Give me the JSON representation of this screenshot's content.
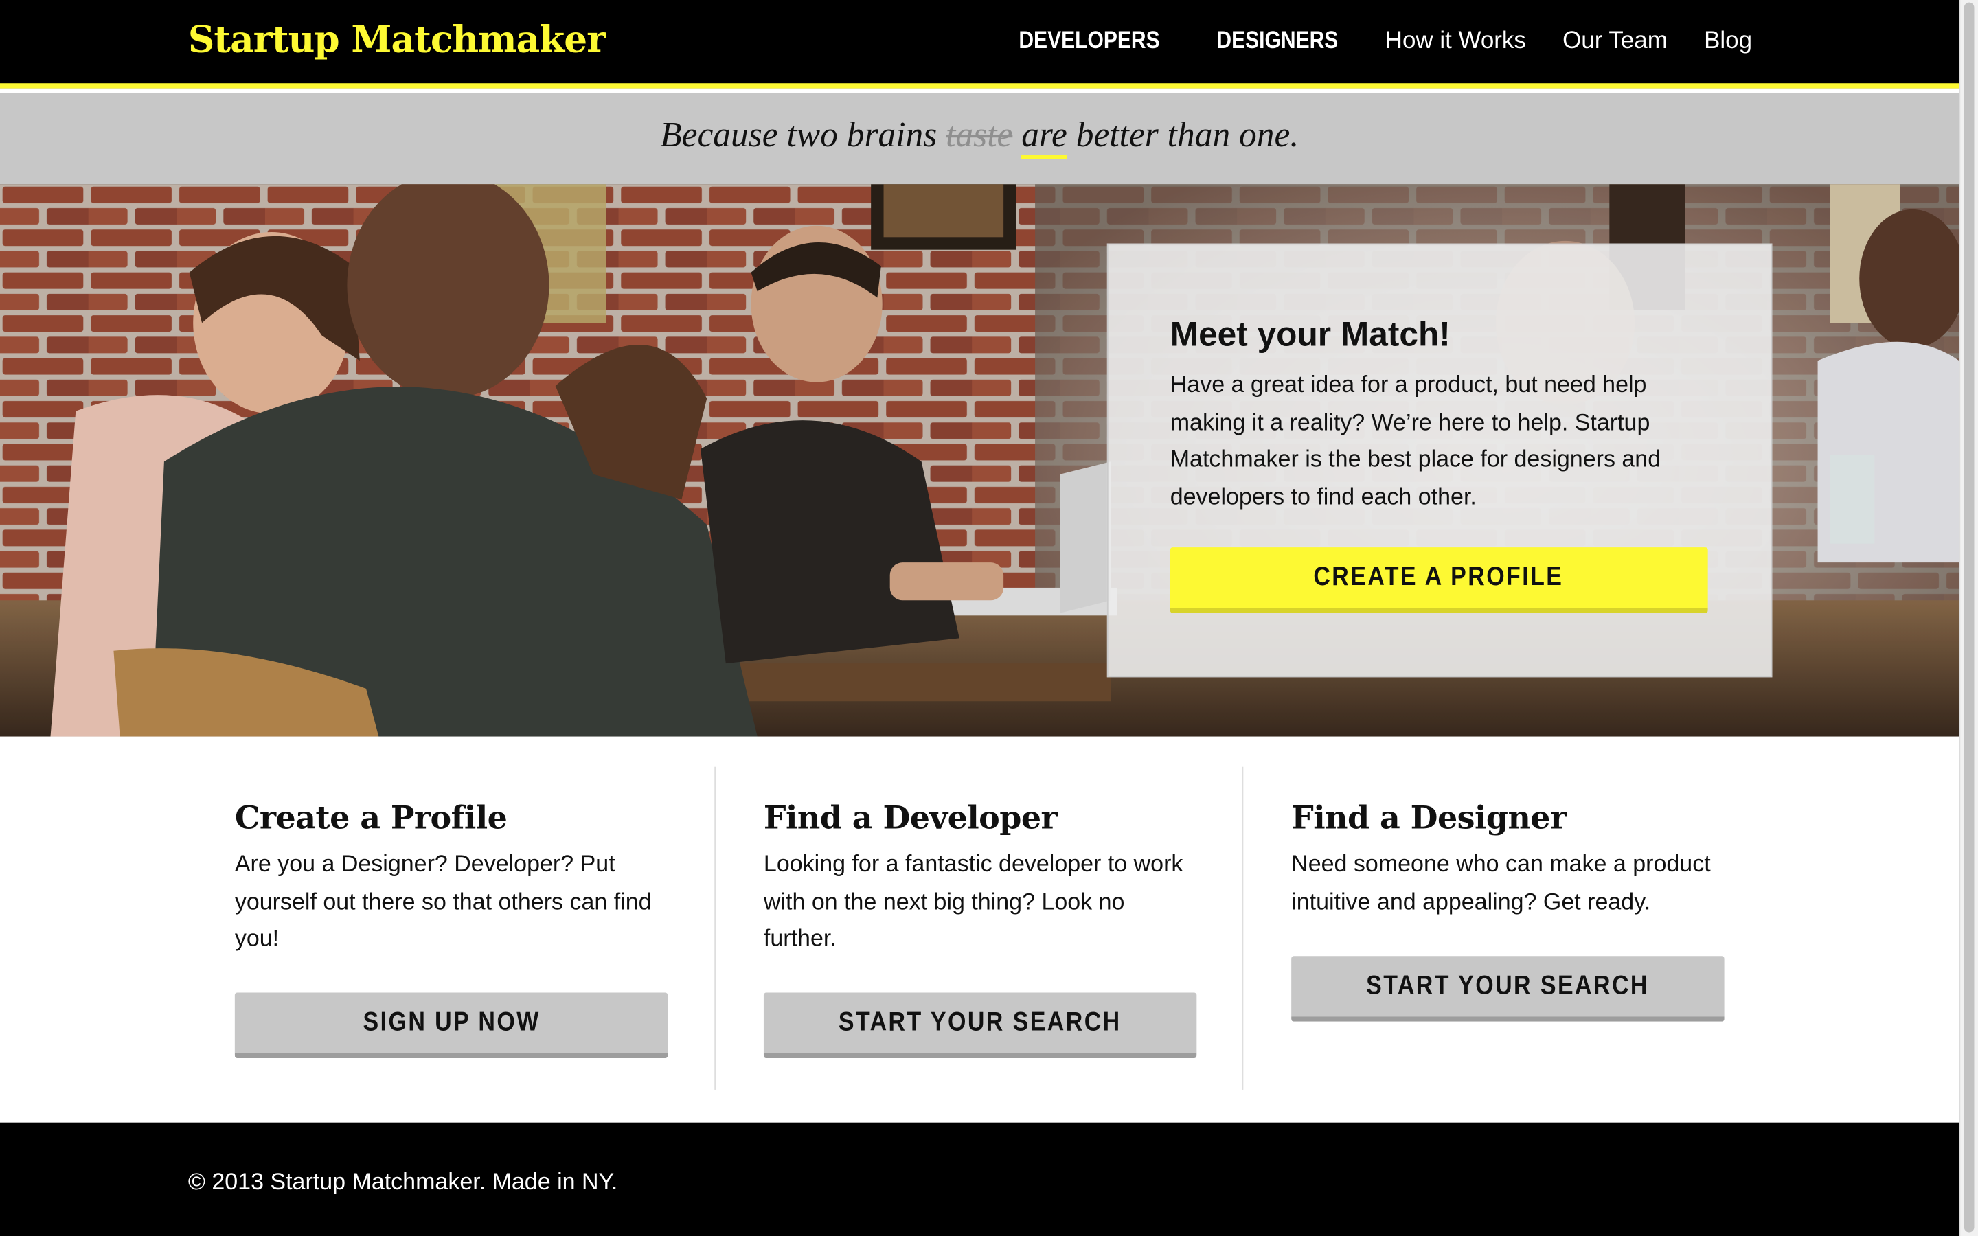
{
  "header": {
    "brand": "Startup Matchmaker",
    "nav": [
      "DEVELOPERS",
      "DESIGNERS",
      "How it Works",
      "Our Team",
      "Blog"
    ]
  },
  "tagline": {
    "before": "Because two brains",
    "struck": "taste",
    "emphasis": "are",
    "after": "better than one."
  },
  "hero": {
    "title": "Meet your Match!",
    "text": "Have a great idea for a product, but need help making it a reality? We’re here to help. Startup Matchmaker is the best place for designers and developers to find each other.",
    "button": "CREATE A PROFILE"
  },
  "features": [
    {
      "title": "Create a Profile",
      "text": "Are you a Designer? Developer? Put yourself out there so that others can find you!",
      "button": "SIGN UP NOW"
    },
    {
      "title": "Find a Developer",
      "text": "Looking for a fantastic developer to work with on the next big thing? Look no further.",
      "button": "START YOUR SEARCH"
    },
    {
      "title": "Find a Designer",
      "text": "Need someone who can make a product intuitive and appealing? Get ready.",
      "button": "START YOUR SEARCH"
    }
  ],
  "footer": {
    "copyright": "© 2013 Startup Matchmaker. Made in NY."
  },
  "colors": {
    "accent": "#fdf933",
    "header_bg": "#000000",
    "tagline_bg": "#c7c7c7",
    "button_gray": "#c7c7c7"
  }
}
